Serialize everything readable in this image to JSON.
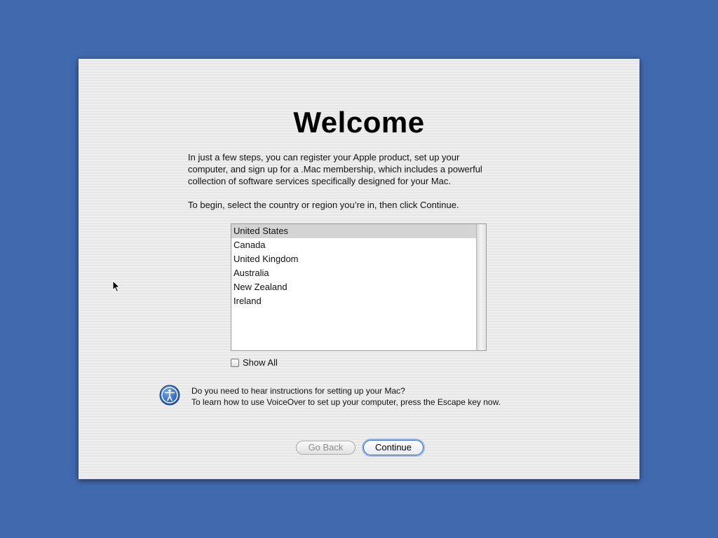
{
  "title": "Welcome",
  "intro": {
    "line1": "In just a few steps, you can register your Apple product, set up your",
    "line2": "computer, and sign up for a .Mac membership, which includes a powerful",
    "line3": "collection of software services specifically designed for your Mac."
  },
  "instruction": "To begin, select the country or region you’re in, then click Continue.",
  "country_list": {
    "items": [
      "United States",
      "Canada",
      "United Kingdom",
      "Australia",
      "New Zealand",
      "Ireland"
    ],
    "selected": "United States"
  },
  "show_all": {
    "label": "Show All",
    "checked": false
  },
  "voiceover": {
    "line1": "Do you need to hear instructions for setting up your Mac?",
    "line2": "To learn how to use VoiceOver to set up your computer, press the Escape key now."
  },
  "buttons": {
    "back_label": "Go Back",
    "continue_label": "Continue"
  },
  "colors": {
    "desktop": "#4169ae",
    "accent": "#3b6cb8"
  },
  "icons": {
    "accessibility": "accessibility-icon",
    "cursor": "mouse-pointer-icon"
  }
}
